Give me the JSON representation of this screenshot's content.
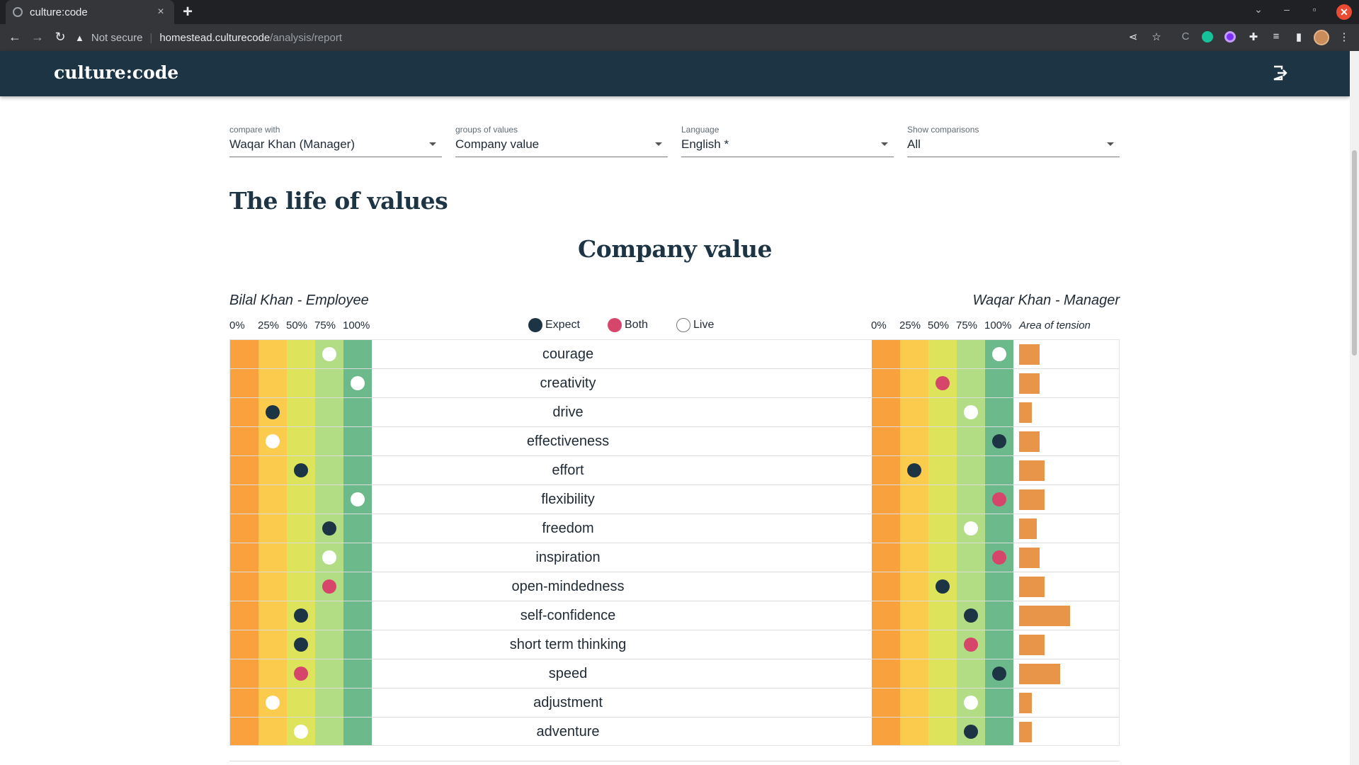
{
  "browser": {
    "tab_title": "culture:code",
    "tab_close": "×",
    "new_tab": "+",
    "not_secure": "Not secure",
    "url_host": "homestead.culturecode",
    "url_path": "/analysis/report"
  },
  "app": {
    "logo": "culture:code"
  },
  "filters": [
    {
      "label": "compare with",
      "value": "Waqar Khan (Manager)"
    },
    {
      "label": "groups of values",
      "value": "Company value"
    },
    {
      "label": "Language",
      "value": "English *"
    },
    {
      "label": "Show comparisons",
      "value": "All"
    }
  ],
  "page_title": "The life of values",
  "section_title": "Company value",
  "left_person": "Bilal Khan - Employee",
  "right_person": "Waqar Khan - Manager",
  "scale_labels": [
    "0%",
    "25%",
    "50%",
    "75%",
    "100%"
  ],
  "tension_label": "Area of tension",
  "legend": [
    {
      "label": "Expect",
      "color": "#1d3444"
    },
    {
      "label": "Both",
      "color": "#d6466a"
    },
    {
      "label": "Live",
      "color": "#ffffff"
    }
  ],
  "colors": {
    "band_0": "#f9a13c",
    "band_25": "#fbcb4e",
    "band_50": "#dde35a",
    "band_75": "#b3dd84",
    "band_100": "#6cb98b",
    "expect": "#1d3444",
    "both": "#d6466a",
    "live": "#ffffff",
    "tension": "#e8954a",
    "header_bg": "#1d3444"
  },
  "rows": [
    {
      "label": "courage",
      "left": {
        "type": "live",
        "pct": 75
      },
      "right": {
        "type": "live",
        "pct": 100
      },
      "tension": 0.4
    },
    {
      "label": "creativity",
      "left": {
        "type": "live",
        "pct": 100
      },
      "right": {
        "type": "both",
        "pct": 50
      },
      "tension": 0.4
    },
    {
      "label": "drive",
      "left": {
        "type": "expect",
        "pct": 25
      },
      "right": {
        "type": "live",
        "pct": 75
      },
      "tension": 0.25
    },
    {
      "label": "effectiveness",
      "left": {
        "type": "live",
        "pct": 25
      },
      "right": {
        "type": "expect",
        "pct": 100
      },
      "tension": 0.4
    },
    {
      "label": "effort",
      "left": {
        "type": "expect",
        "pct": 50
      },
      "right": {
        "type": "expect",
        "pct": 25
      },
      "tension": 0.5
    },
    {
      "label": "flexibility",
      "left": {
        "type": "live",
        "pct": 100
      },
      "right": {
        "type": "both",
        "pct": 100
      },
      "tension": 0.5
    },
    {
      "label": "freedom",
      "left": {
        "type": "expect",
        "pct": 75
      },
      "right": {
        "type": "live",
        "pct": 75
      },
      "tension": 0.35
    },
    {
      "label": "inspiration",
      "left": {
        "type": "live",
        "pct": 75
      },
      "right": {
        "type": "both",
        "pct": 100
      },
      "tension": 0.4
    },
    {
      "label": "open-mindedness",
      "left": {
        "type": "both",
        "pct": 75
      },
      "right": {
        "type": "expect",
        "pct": 50
      },
      "tension": 0.5
    },
    {
      "label": "self-confidence",
      "left": {
        "type": "expect",
        "pct": 50
      },
      "right": {
        "type": "expect",
        "pct": 75
      },
      "tension": 1.0
    },
    {
      "label": "short term thinking",
      "left": {
        "type": "expect",
        "pct": 50
      },
      "right": {
        "type": "both",
        "pct": 75
      },
      "tension": 0.5
    },
    {
      "label": "speed",
      "left": {
        "type": "both",
        "pct": 50
      },
      "right": {
        "type": "expect",
        "pct": 100
      },
      "tension": 0.8
    },
    {
      "label": "adjustment",
      "left": {
        "type": "live",
        "pct": 25
      },
      "right": {
        "type": "live",
        "pct": 75
      },
      "tension": 0.25
    },
    {
      "label": "adventure",
      "left": {
        "type": "live",
        "pct": 50
      },
      "right": {
        "type": "expect",
        "pct": 75
      },
      "tension": 0.25
    }
  ]
}
